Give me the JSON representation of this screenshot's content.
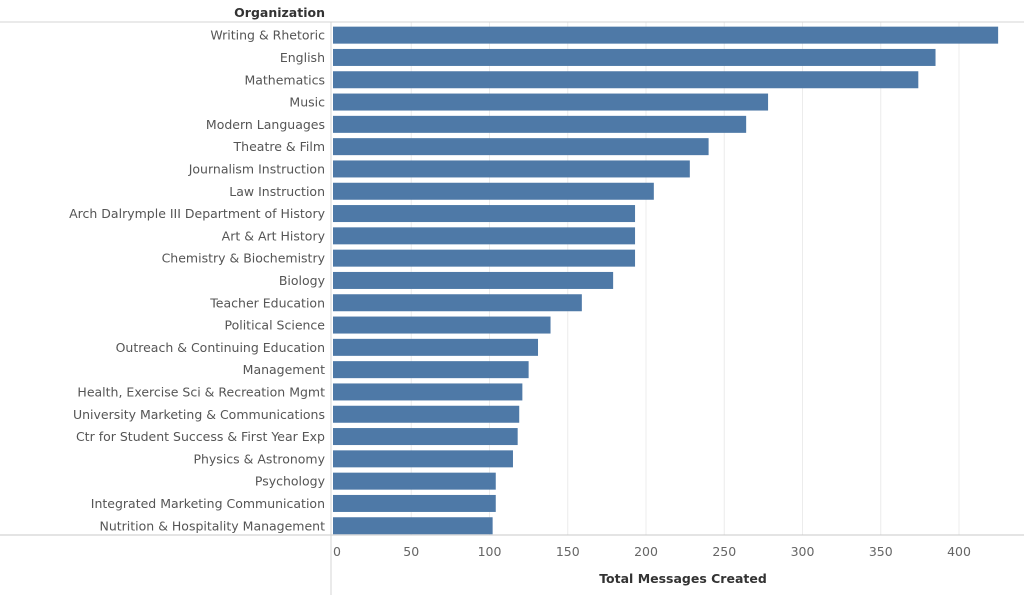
{
  "chart_data": {
    "type": "bar",
    "orientation": "horizontal",
    "row_header": "Organization",
    "xlabel": "Total Messages Created",
    "xlim": [
      0,
      430
    ],
    "xticks": [
      0,
      50,
      100,
      150,
      200,
      250,
      300,
      350,
      400
    ],
    "grid": true,
    "bar_color": "#4e79a7",
    "categories": [
      "Writing & Rhetoric",
      "English",
      "Mathematics",
      "Music",
      "Modern Languages",
      "Theatre & Film",
      "Journalism Instruction",
      "Law Instruction",
      "Arch Dalrymple III Department of History",
      "Art & Art History",
      "Chemistry & Biochemistry",
      "Biology",
      "Teacher Education",
      "Political Science",
      "Outreach & Continuing Education",
      "Management",
      "Health, Exercise Sci & Recreation Mgmt",
      "University Marketing & Communications",
      "Ctr for Student Success & First Year Exp",
      "Physics & Astronomy",
      "Psychology",
      "Integrated Marketing Communication",
      "Nutrition & Hospitality Management"
    ],
    "values": [
      425,
      385,
      374,
      278,
      264,
      240,
      228,
      205,
      193,
      193,
      193,
      179,
      159,
      139,
      131,
      125,
      121,
      119,
      118,
      115,
      104,
      104,
      102
    ]
  }
}
